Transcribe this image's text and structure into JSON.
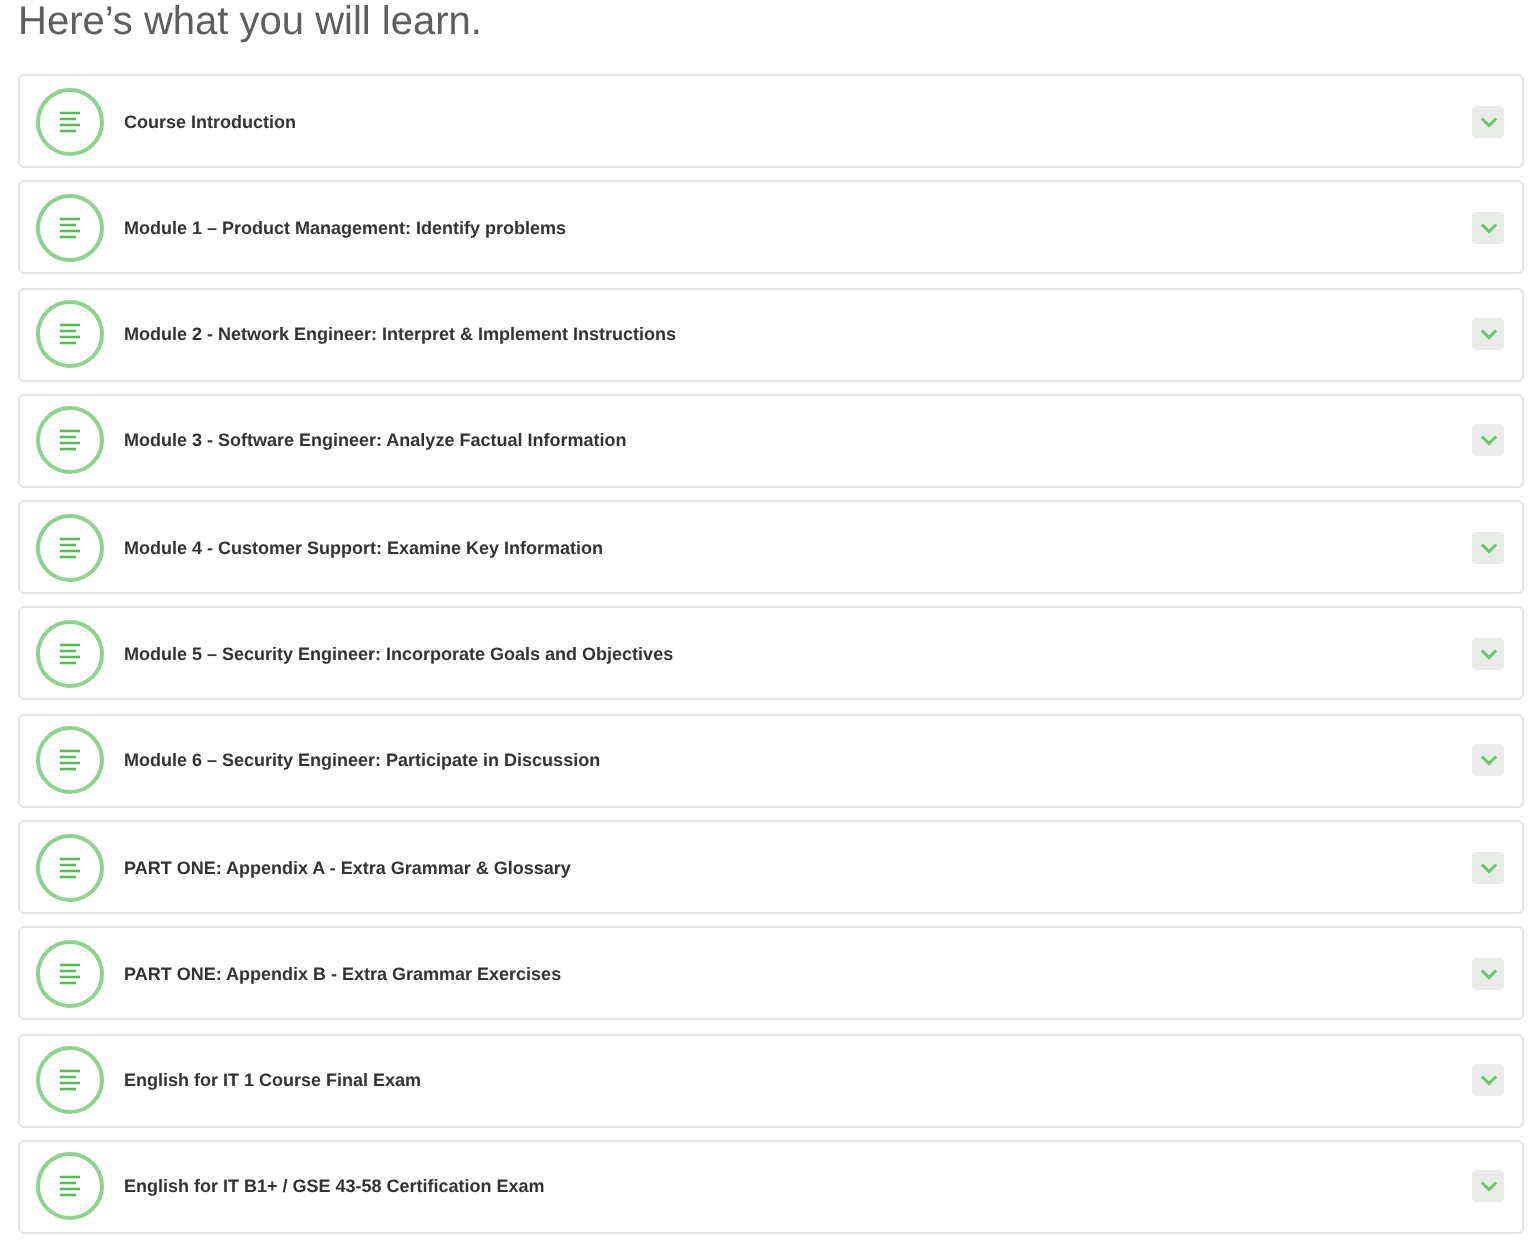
{
  "heading": "Here’s what you will learn.",
  "modules": [
    {
      "title": "Course Introduction",
      "expanded": false
    },
    {
      "title": "Module 1 – Product Management: Identify problems",
      "expanded": false
    },
    {
      "title": "Module 2 - Network Engineer: Interpret & Implement Instructions",
      "expanded": false
    },
    {
      "title": "Module 3 - Software Engineer: Analyze Factual Information",
      "expanded": false
    },
    {
      "title": "Module 4 - Customer Support: Examine Key Information",
      "expanded": false
    },
    {
      "title": "Module 5 – Security Engineer: Incorporate Goals and Objectives",
      "expanded": false
    },
    {
      "title": "Module 6 – Security Engineer: Participate in Discussion",
      "expanded": false
    },
    {
      "title": "PART ONE: Appendix A - Extra Grammar & Glossary",
      "expanded": false
    },
    {
      "title": "PART ONE: Appendix B - Extra Grammar Exercises",
      "expanded": false
    },
    {
      "title": "English for IT 1 Course Final Exam",
      "expanded": false
    },
    {
      "title": "English for IT B1+ / GSE 43-58 Certification Exam",
      "expanded": false
    }
  ]
}
